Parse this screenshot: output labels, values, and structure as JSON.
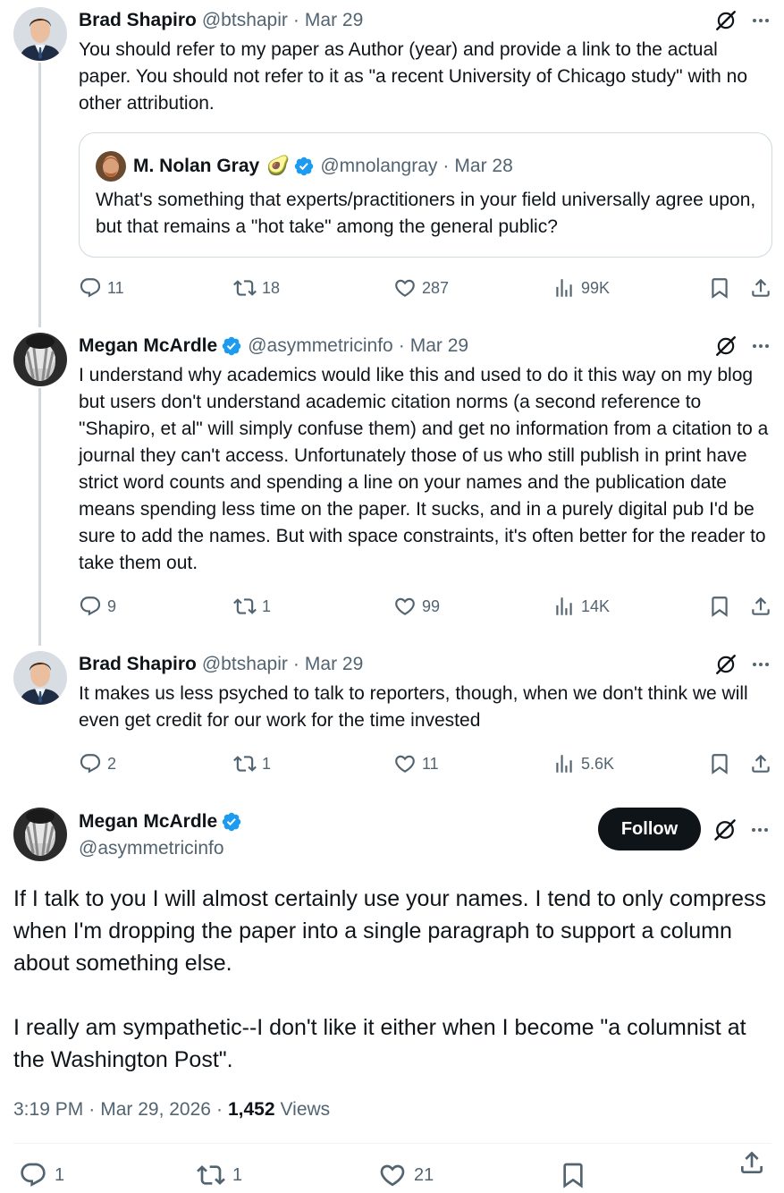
{
  "tweets": [
    {
      "name": "Brad Shapiro",
      "handle": "@btshapir",
      "date": "Mar 29",
      "text": "You should refer to my paper as Author (year) and provide a link to the actual paper. You should not refer to it as \"a recent University of Chicago study\" with no other attribution.",
      "quote": {
        "name": "M. Nolan Gray",
        "emoji": "🥑",
        "handle": "@mnolangray",
        "date": "Mar 28",
        "text": "What's something that experts/practitioners in your field universally agree upon, but that remains a \"hot take\" among the general public?"
      },
      "stats": {
        "replies": "11",
        "reposts": "18",
        "likes": "287",
        "views": "99K"
      }
    },
    {
      "name": "Megan McArdle",
      "handle": "@asymmetricinfo",
      "date": "Mar 29",
      "text": "I understand why academics would like this and used to do it this way on my blog but users don't understand academic citation norms (a second reference to \"Shapiro, et al\" will simply confuse them) and get no information from a citation to a journal they can't access. Unfortunately those of us who still publish in print have strict word counts and spending a line on your names and the publication date means spending less time on the paper. It sucks, and in a purely digital pub I'd be sure to add the names. But with space constraints, it's often better for the reader to take them out.",
      "stats": {
        "replies": "9",
        "reposts": "1",
        "likes": "99",
        "views": "14K"
      }
    },
    {
      "name": "Brad Shapiro",
      "handle": "@btshapir",
      "date": "Mar 29",
      "text": "It makes us less psyched to talk to reporters, though, when we don't think we will even get credit for our work for the time invested",
      "stats": {
        "replies": "2",
        "reposts": "1",
        "likes": "11",
        "views": "5.6K"
      }
    }
  ],
  "main_tweet": {
    "name": "Megan McArdle",
    "handle": "@asymmetricinfo",
    "follow_label": "Follow",
    "paragraph1": "If I talk to you I will almost certainly use your names. I tend to only compress when I'm dropping the paper into a single paragraph to support a column about something else.",
    "paragraph2": "I really am sympathetic--I don't like it either when I become \"a columnist at the Washington Post\".",
    "time": "3:19 PM",
    "full_date": "Mar 29, 2026",
    "views_count": "1,452",
    "views_label": "Views",
    "stats": {
      "replies": "1",
      "reposts": "1",
      "likes": "21"
    }
  },
  "colors": {
    "verified": "#1d9bf0",
    "text_primary": "#0f1419",
    "text_secondary": "#536471",
    "follow_button": "#0f1419"
  },
  "icons": [
    "reply-icon",
    "repost-icon",
    "like-icon",
    "views-icon",
    "bookmark-icon",
    "share-icon",
    "grok-icon",
    "more-icon",
    "verified-badge-icon"
  ]
}
